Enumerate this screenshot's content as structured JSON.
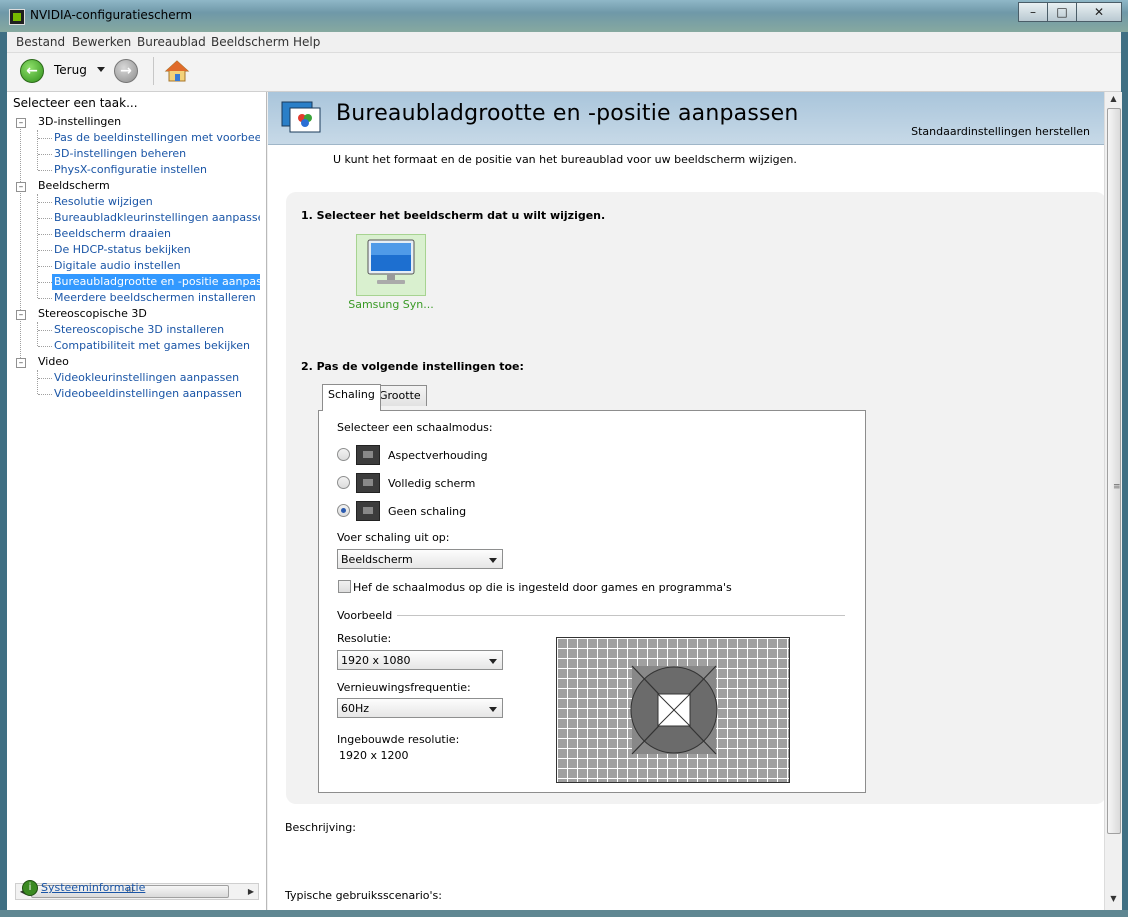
{
  "window": {
    "title": "NVIDIA-configuratiescherm"
  },
  "menu": [
    "Bestand",
    "Bewerken",
    "Bureaublad",
    "Beeldscherm",
    "Help"
  ],
  "toolbar": {
    "back_label": "Terug"
  },
  "sidebar": {
    "header": "Selecteer een taak...",
    "tree": [
      {
        "label": "3D-instellingen",
        "children": [
          "Pas de beeldinstellingen met voorbeeld aan",
          "3D-instellingen beheren",
          "PhysX-configuratie instellen"
        ]
      },
      {
        "label": "Beeldscherm",
        "children": [
          "Resolutie wijzigen",
          "Bureaubladkleurinstellingen aanpassen",
          "Beeldscherm draaien",
          "De HDCP-status bekijken",
          "Digitale audio instellen",
          "Bureaubladgrootte en -positie aanpassen",
          "Meerdere beeldschermen installeren"
        ]
      },
      {
        "label": "Stereoscopische 3D",
        "children": [
          "Stereoscopische 3D installeren",
          "Compatibiliteit met games bekijken"
        ]
      },
      {
        "label": "Video",
        "children": [
          "Videokleurinstellingen aanpassen",
          "Videobeeldinstellingen aanpassen"
        ]
      }
    ],
    "selected": "Bureaubladgrootte en -positie aanpassen",
    "hscroll_glyph": "III",
    "sysinfo_label": "Systeeminformatie"
  },
  "main": {
    "title": "Bureaubladgrootte en -positie aanpassen",
    "restore_label": "Standaardinstellingen herstellen",
    "intro": "U kunt het formaat en de positie van het bureaublad voor uw beeldscherm wijzigen.",
    "step1": "1. Selecteer het beeldscherm dat u wilt wijzigen.",
    "monitor_label": "Samsung Syn...",
    "step2": "2. Pas de volgende instellingen toe:",
    "tabs": [
      "Schaling",
      "Grootte"
    ],
    "active_tab": "Schaling",
    "scaling": {
      "mode_label": "Selecteer een schaalmodus:",
      "modes": [
        "Aspectverhouding",
        "Volledig scherm",
        "Geen schaling"
      ],
      "selected_mode": "Geen schaling",
      "perform_on_label": "Voer schaling uit op:",
      "perform_on_value": "Beeldscherm",
      "override_label": "Hef de schaalmodus op die is ingesteld door games en programma's",
      "override_checked": false
    },
    "preview": {
      "group_label": "Voorbeeld",
      "resolution_label": "Resolutie:",
      "resolution_value": "1920 x 1080",
      "refresh_label": "Vernieuwingsfrequentie:",
      "refresh_value": "60Hz",
      "native_label": "Ingebouwde resolutie:",
      "native_value": "1920 x 1200"
    },
    "description_label": "Beschrijving:",
    "typical_label": "Typische gebruiksscenario's:"
  },
  "colors": {
    "link": "#1a55a6",
    "selection": "#3399ff",
    "monitor_label": "#3a9a26",
    "banner": "#a9c5db"
  }
}
